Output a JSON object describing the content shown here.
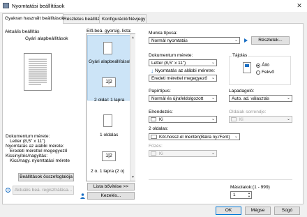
{
  "window": {
    "title": "Nyomtatási beállítások"
  },
  "tabs": [
    "Gyakran használt beállítások",
    "Részletes beállítás",
    "Konfiguráció/Névjegy"
  ],
  "current_settings": {
    "heading": "Aktuális beállítás",
    "preset": "Gyári alapbeállítások",
    "summary": [
      "Dokumentum mérete:",
      "Letter (8,5\" x 11\")",
      "Nyomtatás az alábbi mérete:",
      "Eredeti mérettel megegyező",
      "Kicsinyítés/nagyítás:",
      "Kics/nagy. nyomtatási mérete"
    ],
    "summary_button": "Beállítások összefoglalója",
    "register_button": "Aktuális beá. regisztrálása..."
  },
  "quick_list": {
    "label": "Elő.beá. gyorsig. lista:",
    "items": [
      "Gyári alapbeállítások",
      "2 oldal: 1 lapra",
      "1 oldalas",
      "2 o. 1 lapra (2 o)"
    ],
    "expand_button": "Lista bővítése >>",
    "manage_button": "Kezelés..."
  },
  "settings": {
    "job_type_label": "Munka típusa:",
    "job_type_value": "Normál nyomtatás",
    "details_button": "Részletek...",
    "doc_size_label": "Dokumentum mérete:",
    "doc_size_value": "Letter (8,5\" x 11\")",
    "print_size_label": "Nyomtatás az alábbi méretre:",
    "print_size_value": "Eredeti mérettel megegyező",
    "orientation_label": "Tájolás",
    "orientation_options": [
      "Álló",
      "Fekvő"
    ],
    "orientation_selected": "Álló",
    "paper_type_label": "Papírtípus:",
    "paper_type_value": "Normál és újrafeldolgozott",
    "tray_label": "Lapadagoló:",
    "tray_value": "Auto. ad. választás",
    "layout_label": "Elrendezés:",
    "layout_value": "Ki",
    "page_order_label": "Oldalak sorrendje:",
    "page_order_value": "Ki",
    "two_sided_label": "2 oldalas:",
    "two_sided_value": "Köt.hossz.él mentén(Balra ny./Fent)",
    "staple_label": "Fűzés:",
    "staple_value": "Ki",
    "copies_label": "Másolatok:(1 - 999)",
    "copies_value": "1"
  },
  "footer": {
    "ok": "OK",
    "cancel": "Mégse",
    "help": "Súgó"
  }
}
